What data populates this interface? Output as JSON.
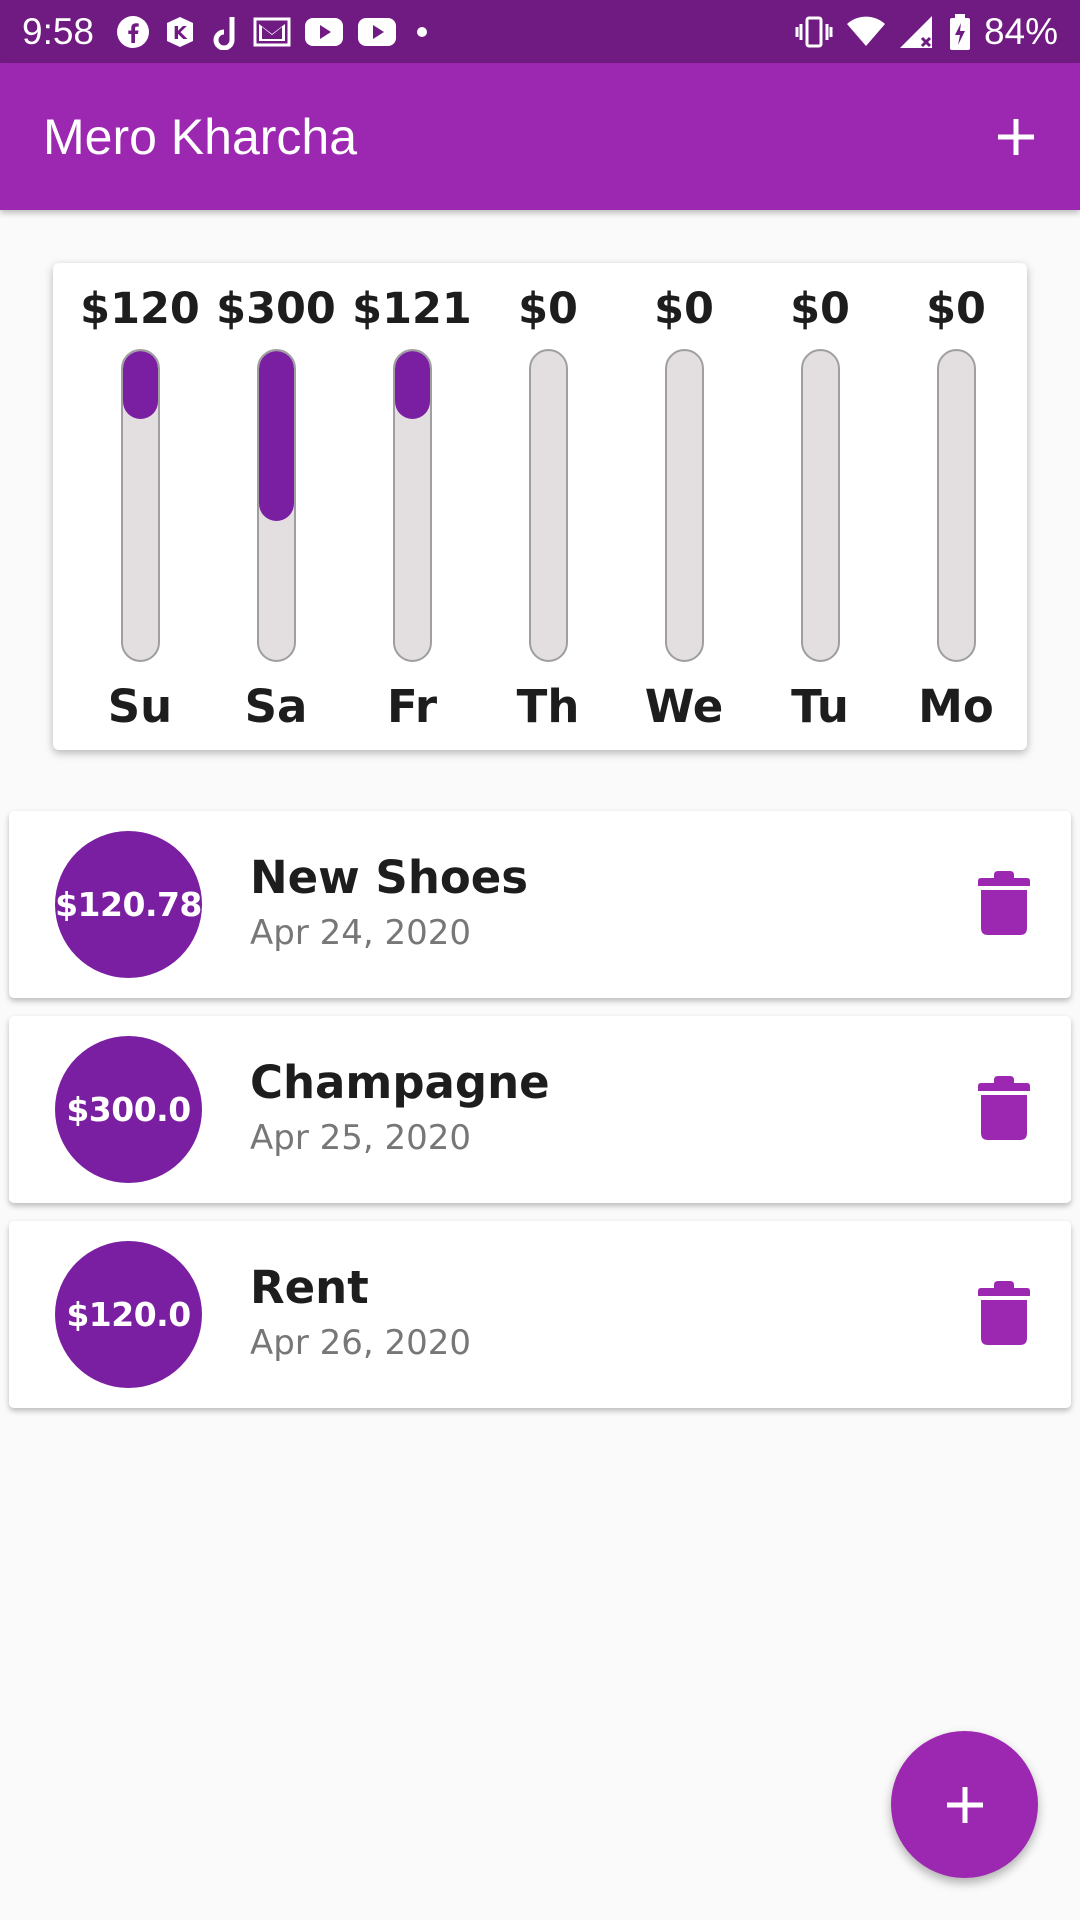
{
  "status_bar": {
    "time": "9:58",
    "notification_icons": [
      "facebook-icon",
      "kik-icon",
      "tiktok-icon",
      "gmail-icon",
      "youtube-icon",
      "youtube-icon",
      "dot-icon"
    ],
    "system_icons": [
      "vibrate-icon",
      "wifi-icon",
      "signal-icon",
      "battery-charging-icon"
    ],
    "battery_percent": "84%"
  },
  "app_bar": {
    "title": "Mero Kharcha",
    "add_icon": "plus-icon"
  },
  "colors": {
    "status_bar": "#701b82",
    "app_bar": "#9c27b0",
    "accent": "#7b1fa2",
    "track": "#e3dedf"
  },
  "chart_data": {
    "type": "bar",
    "categories": [
      "Su",
      "Sa",
      "Fr",
      "Th",
      "We",
      "Tu",
      "Mo"
    ],
    "value_labels": [
      "$120",
      "$300",
      "$121",
      "$0",
      "$0",
      "$0",
      "$0"
    ],
    "fill_fraction": [
      0.22,
      0.55,
      0.22,
      0,
      0,
      0,
      0
    ]
  },
  "transactions": [
    {
      "amount": "$120.78",
      "title": "New Shoes",
      "date": "Apr 24, 2020",
      "delete_icon": "trash-icon"
    },
    {
      "amount": "$300.0",
      "title": "Champagne",
      "date": "Apr 25, 2020",
      "delete_icon": "trash-icon"
    },
    {
      "amount": "$120.0",
      "title": "Rent",
      "date": "Apr 26, 2020",
      "delete_icon": "trash-icon"
    }
  ],
  "fab": {
    "icon": "plus-icon"
  }
}
